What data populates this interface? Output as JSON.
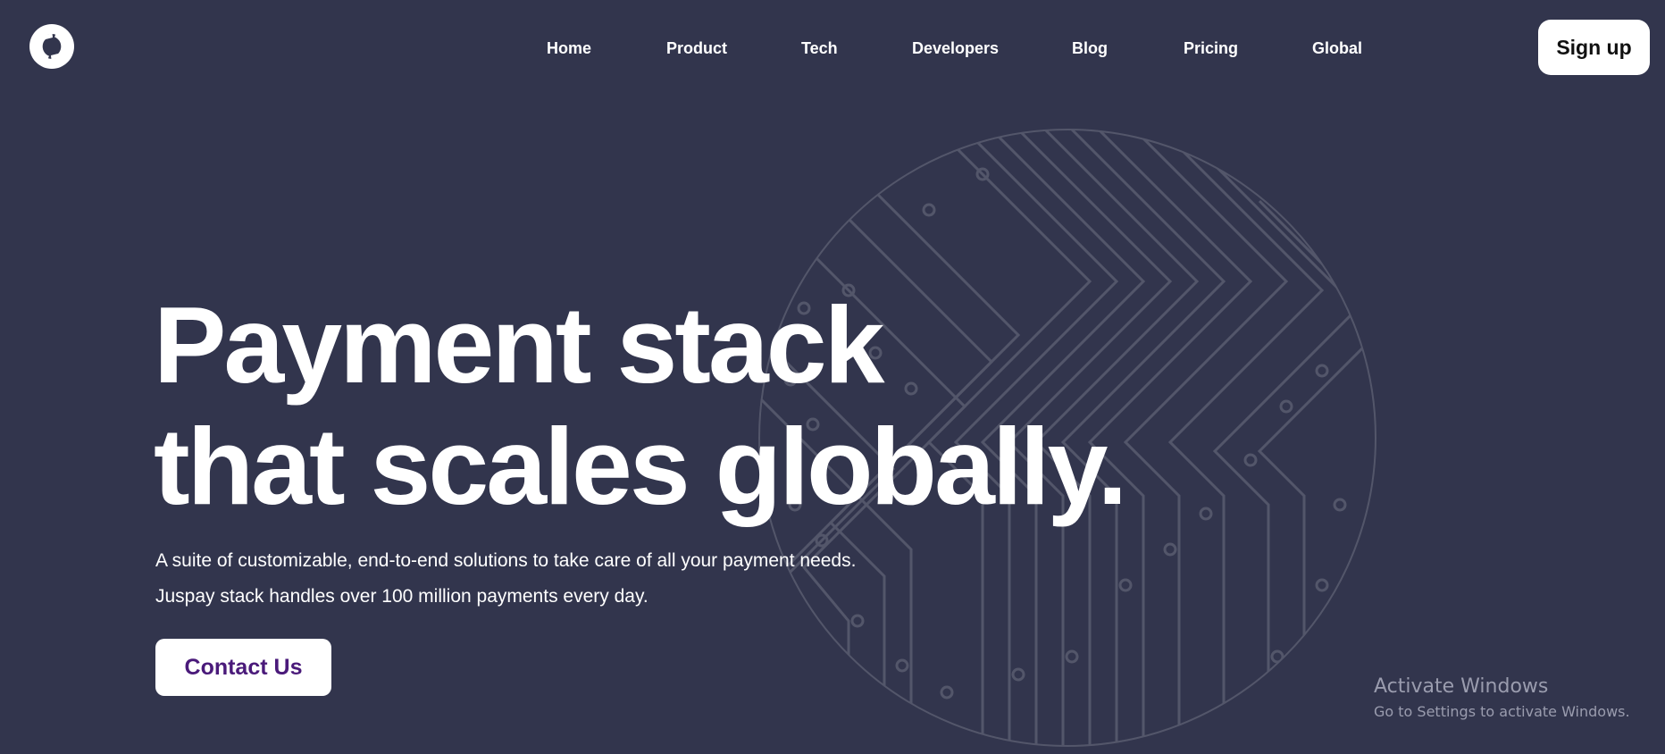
{
  "header": {
    "logo": {
      "icon": "juspay-logo-icon"
    },
    "nav": [
      {
        "label": "Home"
      },
      {
        "label": "Product"
      },
      {
        "label": "Tech"
      },
      {
        "label": "Developers"
      },
      {
        "label": "Blog"
      },
      {
        "label": "Pricing"
      },
      {
        "label": "Global"
      }
    ],
    "signup_label": "Sign up"
  },
  "hero": {
    "title_line1": "Payment stack",
    "title_line2": "that scales globally.",
    "subtitle_line1": "A suite of customizable, end-to-end solutions to take care of all your payment needs.",
    "subtitle_line2": "Juspay stack handles over 100 million payments every day.",
    "cta_label": "Contact Us",
    "background_icon": "circuit-globe-icon"
  },
  "watermark": {
    "title": "Activate Windows",
    "subtitle": "Go to Settings to activate Windows."
  },
  "colors": {
    "background": "#32354d",
    "text": "#ffffff",
    "cta_text": "#4a1a7a",
    "watermark": "#9a9cae"
  }
}
